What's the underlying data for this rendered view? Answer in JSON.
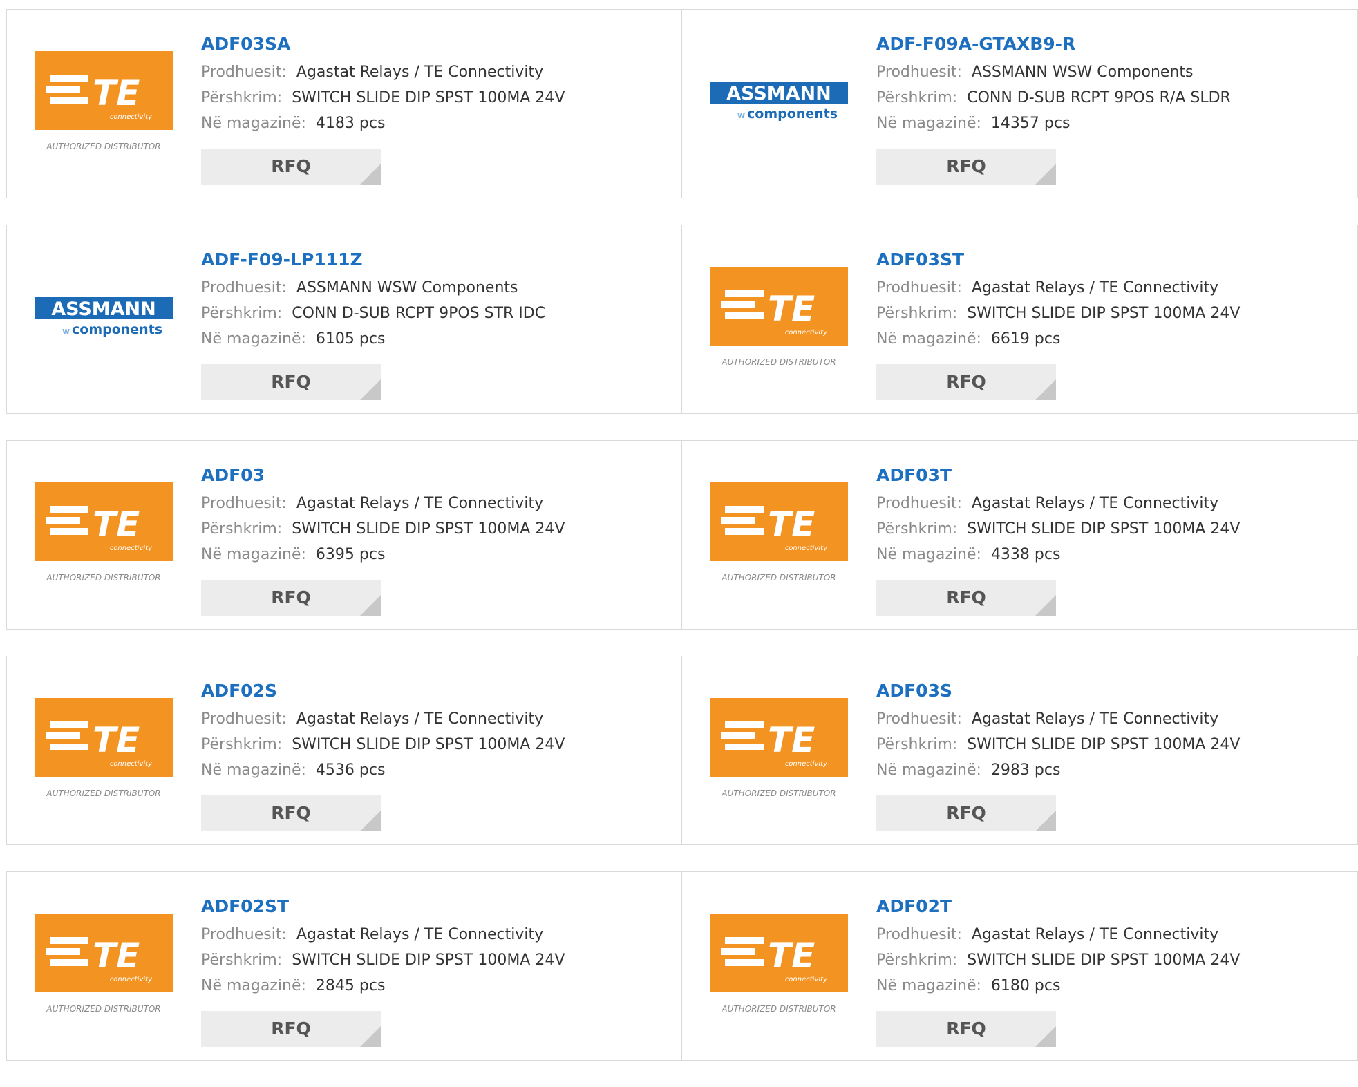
{
  "labels": {
    "manufacturer": "Prodhuesit:",
    "description": "Përshkrim:",
    "stock": "Në magazinë:",
    "rfq": "RFQ"
  },
  "logos": {
    "te": {
      "main": "TE",
      "sub": "connectivity",
      "caption": "AUTHORIZED DISTRIBUTOR",
      "bg_color": "#f39322"
    },
    "assmann": {
      "main": "ASSMANN",
      "sub": "components",
      "prefix": "w",
      "color": "#1c6bb6"
    }
  },
  "products": [
    {
      "part": "ADF03SA",
      "logo": "te",
      "manufacturer": "Agastat Relays / TE Connectivity",
      "description": "SWITCH SLIDE DIP SPST 100MA 24V",
      "stock": "4183 pcs"
    },
    {
      "part": "ADF-F09A-GTAXB9-R",
      "logo": "assmann",
      "manufacturer": "ASSMANN WSW Components",
      "description": "CONN D-SUB RCPT 9POS R/A SLDR",
      "stock": "14357 pcs"
    },
    {
      "part": "ADF-F09-LP111Z",
      "logo": "assmann",
      "manufacturer": "ASSMANN WSW Components",
      "description": "CONN D-SUB RCPT 9POS STR IDC",
      "stock": "6105 pcs"
    },
    {
      "part": "ADF03ST",
      "logo": "te",
      "manufacturer": "Agastat Relays / TE Connectivity",
      "description": "SWITCH SLIDE DIP SPST 100MA 24V",
      "stock": "6619 pcs"
    },
    {
      "part": "ADF03",
      "logo": "te",
      "manufacturer": "Agastat Relays / TE Connectivity",
      "description": "SWITCH SLIDE DIP SPST 100MA 24V",
      "stock": "6395 pcs"
    },
    {
      "part": "ADF03T",
      "logo": "te",
      "manufacturer": "Agastat Relays / TE Connectivity",
      "description": "SWITCH SLIDE DIP SPST 100MA 24V",
      "stock": "4338 pcs"
    },
    {
      "part": "ADF02S",
      "logo": "te",
      "manufacturer": "Agastat Relays / TE Connectivity",
      "description": "SWITCH SLIDE DIP SPST 100MA 24V",
      "stock": "4536 pcs"
    },
    {
      "part": "ADF03S",
      "logo": "te",
      "manufacturer": "Agastat Relays / TE Connectivity",
      "description": "SWITCH SLIDE DIP SPST 100MA 24V",
      "stock": "2983 pcs"
    },
    {
      "part": "ADF02ST",
      "logo": "te",
      "manufacturer": "Agastat Relays / TE Connectivity",
      "description": "SWITCH SLIDE DIP SPST 100MA 24V",
      "stock": "2845 pcs"
    },
    {
      "part": "ADF02T",
      "logo": "te",
      "manufacturer": "Agastat Relays / TE Connectivity",
      "description": "SWITCH SLIDE DIP SPST 100MA 24V",
      "stock": "6180 pcs"
    }
  ]
}
